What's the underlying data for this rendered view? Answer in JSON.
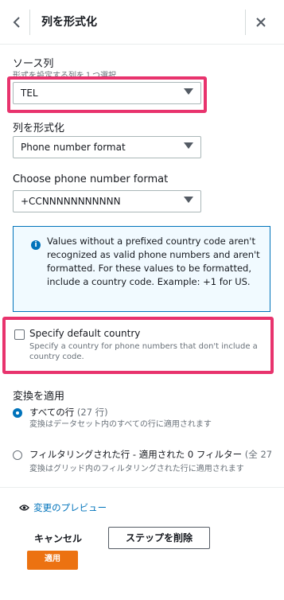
{
  "header": {
    "back_icon": "chevron-left-icon",
    "title": "列を形式化",
    "close_icon": "close-icon"
  },
  "source_column": {
    "label": "ソース列",
    "description": "形式を設定する列を１つ選択",
    "selected": "TEL"
  },
  "format_column": {
    "label": "列を形式化",
    "selected": "Phone number format"
  },
  "phone_format": {
    "label": "Choose phone number format",
    "selected": "+CCNNNNNNNNNNN"
  },
  "info": {
    "icon": "info-icon",
    "text": "Values without a prefixed country code aren't recognized as valid phone numbers and aren't formatted. For these values to be formatted, include a country code. Example: +1 for US."
  },
  "default_country": {
    "checked": false,
    "label": "Specify default country",
    "description": "Specify a country for phone numbers that don't include a country code."
  },
  "apply": {
    "label": "変換を適用",
    "options": [
      {
        "title": "すべての行",
        "count": "(27 行)",
        "description": "変換はデータセット内のすべての行に適用されます",
        "selected": true
      },
      {
        "title": "フィルタリングされた行 - 適用された 0 フィルター",
        "count": "(全 27",
        "description": "変換はグリッド内のフィルタリングされた行に適用されます",
        "selected": false
      }
    ]
  },
  "preview": {
    "icon": "eye-icon",
    "label": "変更のプレビュー"
  },
  "footer": {
    "cancel_label": "キャンセル",
    "delete_label": "ステップを削除",
    "apply_label": "適用"
  },
  "colors": {
    "accent": "#0073bb",
    "highlight": "#e8336d",
    "primary_button": "#ec7211"
  }
}
